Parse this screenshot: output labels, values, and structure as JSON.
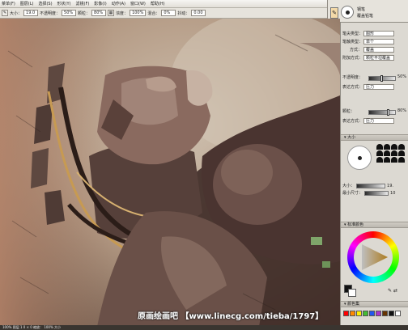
{
  "menubar": {
    "items": [
      "菜单(F)",
      "图层(L)",
      "选择(S)",
      "形状(Y)",
      "滤镜(F)",
      "影像(I)",
      "动作(A)",
      "窗口(W)",
      "帮助(H)"
    ]
  },
  "options": {
    "size_label": "大小：",
    "size_value": "19.0",
    "opacity_label": "不透明度：",
    "opacity_value": "50%",
    "grain_label": "颗粒：",
    "grain_value": "80%",
    "blend_label": "浓度：",
    "blend_value": "100%",
    "mix_label": "混合：",
    "mix_value": "0%",
    "jitter_label": "抖动：",
    "jitter_value": "0.00"
  },
  "brush": {
    "category": "钢笔",
    "variant": "覆盖铅笔"
  },
  "properties": {
    "stroke_type_label": "笔尖类型：",
    "stroke_type_value": "图形",
    "dab_label": "笔触类型：",
    "dab_value": "单个",
    "method_label": "方式：",
    "method_value": "覆盖",
    "sub_label": "附加方式：",
    "sub_value": "颗粒平坦覆盖"
  },
  "sliders": {
    "opacity_label": "不透明度：",
    "opacity_value": "50%",
    "opacity_level": 0.5,
    "expr1_label": "表达方式：",
    "expr1_value": "压力",
    "grain_label": "颗粒：",
    "grain_value": "80%",
    "grain_level": 0.8,
    "expr2_label": "表达方式：",
    "expr2_value": "压力"
  },
  "size_panel": {
    "title": "大小",
    "size_label": "大小：",
    "size_value": "19.",
    "min_label": "最小尺寸：",
    "min_value": "10"
  },
  "color_panel": {
    "title": "标准颜色"
  },
  "mixer_panel": {
    "title": "颜色集"
  },
  "swatches": [
    "#ff0000",
    "#ff8800",
    "#ffee00",
    "#44bb33",
    "#2255ee",
    "#aa33cc",
    "#663300",
    "#111111",
    "#ffffff"
  ],
  "watermark": "原画绘画吧 【www.linecg.com/tieba/1797】",
  "statusbar": "100%  图层 1  0 × 0  缩放：  100%  大小"
}
